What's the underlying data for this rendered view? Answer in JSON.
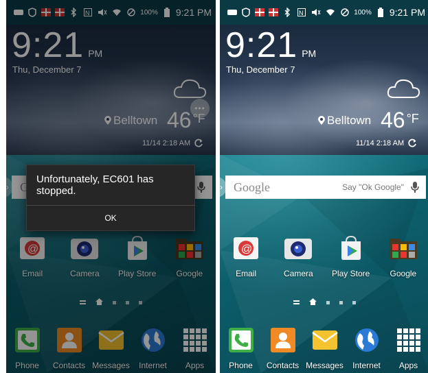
{
  "status_bar": {
    "battery_pct": "100%",
    "time": "9:21 PM"
  },
  "clock": {
    "time": "9:21",
    "ampm": "PM",
    "date": "Thu, December 7"
  },
  "weather": {
    "location": "Belltown",
    "temp": "46",
    "unit": "°F",
    "updated": "11/14 2:18 AM"
  },
  "search": {
    "logo": "Google",
    "hint": "Say \"Ok Google\""
  },
  "apps": [
    {
      "label": "Email",
      "icon": "email-icon"
    },
    {
      "label": "Camera",
      "icon": "camera-icon"
    },
    {
      "label": "Play Store",
      "icon": "play-store-icon"
    },
    {
      "label": "Google",
      "icon": "google-folder-icon"
    }
  ],
  "dock": [
    {
      "label": "Phone",
      "icon": "phone-icon"
    },
    {
      "label": "Contacts",
      "icon": "contacts-icon"
    },
    {
      "label": "Messages",
      "icon": "messages-icon"
    },
    {
      "label": "Internet",
      "icon": "internet-icon"
    },
    {
      "label": "Apps",
      "icon": "apps-grid-icon"
    }
  ],
  "dialog": {
    "message": "Unfortunately, EC601 has stopped.",
    "ok_label": "OK"
  },
  "colors": {
    "status_bar": "#0b3a44",
    "wallpaper": "#137a86",
    "dialog_bg": "#262626"
  }
}
